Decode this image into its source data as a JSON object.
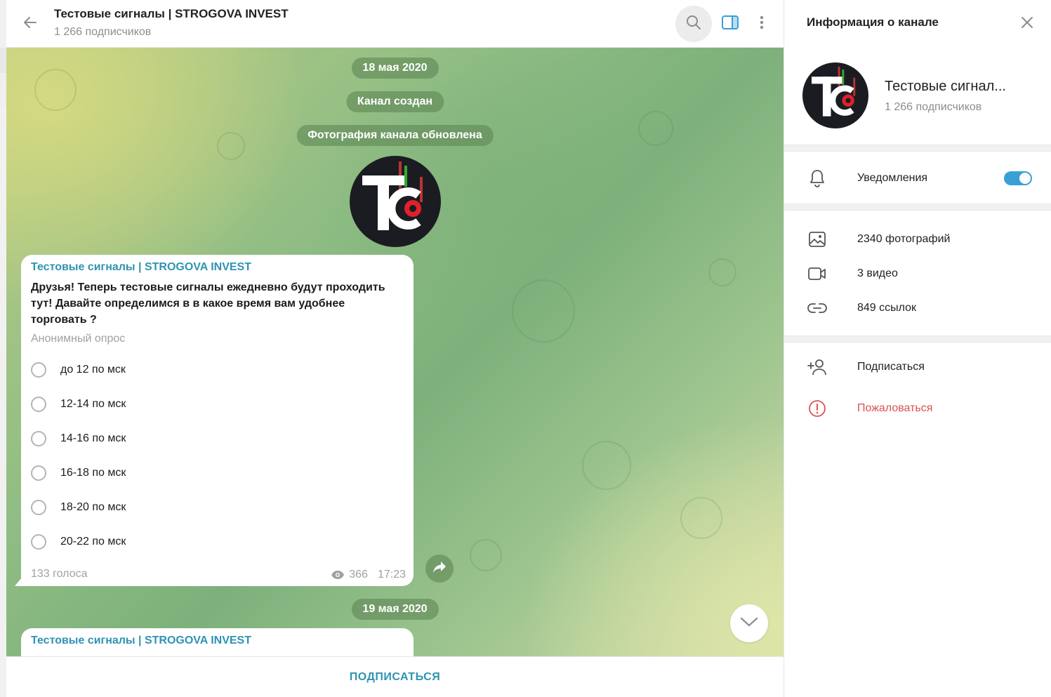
{
  "chat_header": {
    "title": "Тестовые сигналы | STROGOVA INVEST",
    "subtitle": "1 266 подписчиков"
  },
  "messages": {
    "date1": "18 мая 2020",
    "service1": "Канал создан",
    "service2": "Фотография канала обновлена",
    "date2": "19 мая 2020"
  },
  "poll": {
    "sender": "Тестовые сигналы | STROGOVA INVEST",
    "question": "Друзья! Теперь тестовые сигналы ежедневно будут проходить тут! Давайте определимся в в какое время вам удобнее торговать ?",
    "type": "Анонимный опрос",
    "options": [
      "до 12 по мск",
      "12-14 по мск",
      "14-16 по мск",
      "16-18 по мск",
      "18-20 по мск",
      "20-22 по мск"
    ],
    "votes": "133 голоса",
    "views": "366",
    "time": "17:23"
  },
  "second_message": {
    "sender": "Тестовые сигналы | STROGOVA INVEST"
  },
  "bottom_bar": {
    "subscribe": "ПОДПИСАТЬСЯ"
  },
  "info_panel": {
    "title": "Информация о канале",
    "channel_name": "Тестовые сигнал...",
    "subscribers": "1 266 подписчиков",
    "notifications": {
      "label": "Уведомления",
      "enabled": true
    },
    "media": {
      "photos": "2340 фотографий",
      "videos": "3 видео",
      "links": "849 ссылок"
    },
    "subscribe": "Подписаться",
    "report": "Пожаловаться"
  },
  "avatar": {
    "letters": "Tc",
    "accent": "#e0212a"
  },
  "colors": {
    "accent": "#2f93b4",
    "toggle": "#3a9fd6",
    "danger": "#d9534f"
  },
  "icons": [
    "back-arrow-icon",
    "search-icon",
    "side-panel-icon",
    "more-vertical-icon",
    "eye-icon",
    "share-icon",
    "chevron-down-icon",
    "close-icon",
    "bell-icon",
    "photo-icon",
    "video-icon",
    "link-icon",
    "add-user-icon",
    "report-icon"
  ]
}
